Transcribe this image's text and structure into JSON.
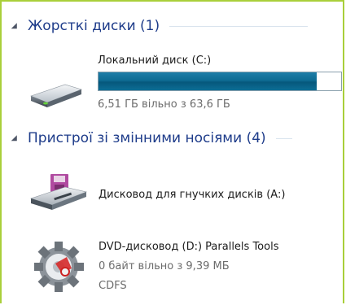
{
  "groups": [
    {
      "title": "Жорсткі диски (1)"
    },
    {
      "title": "Пристрої зі змінними носіями (4)"
    }
  ],
  "items": [
    {
      "label": "Локальний диск (C:)",
      "sub": "6,51 ГБ вільно з 63,6 ГБ",
      "used_fraction": 0.898,
      "icon": "hard-drive-icon"
    },
    {
      "label": "Дисковод для гнучких дисків (A:)",
      "icon": "floppy-drive-icon"
    },
    {
      "label": "DVD-дисковод (D:) Parallels Tools",
      "sub": "0 байт вільно з 9,39 МБ",
      "sub2": "CDFS",
      "icon": "dvd-drive-icon"
    }
  ],
  "colors": {
    "frame": "#a9cf3a",
    "group_title": "#1e3c8a",
    "bar": "#0e6b93"
  }
}
